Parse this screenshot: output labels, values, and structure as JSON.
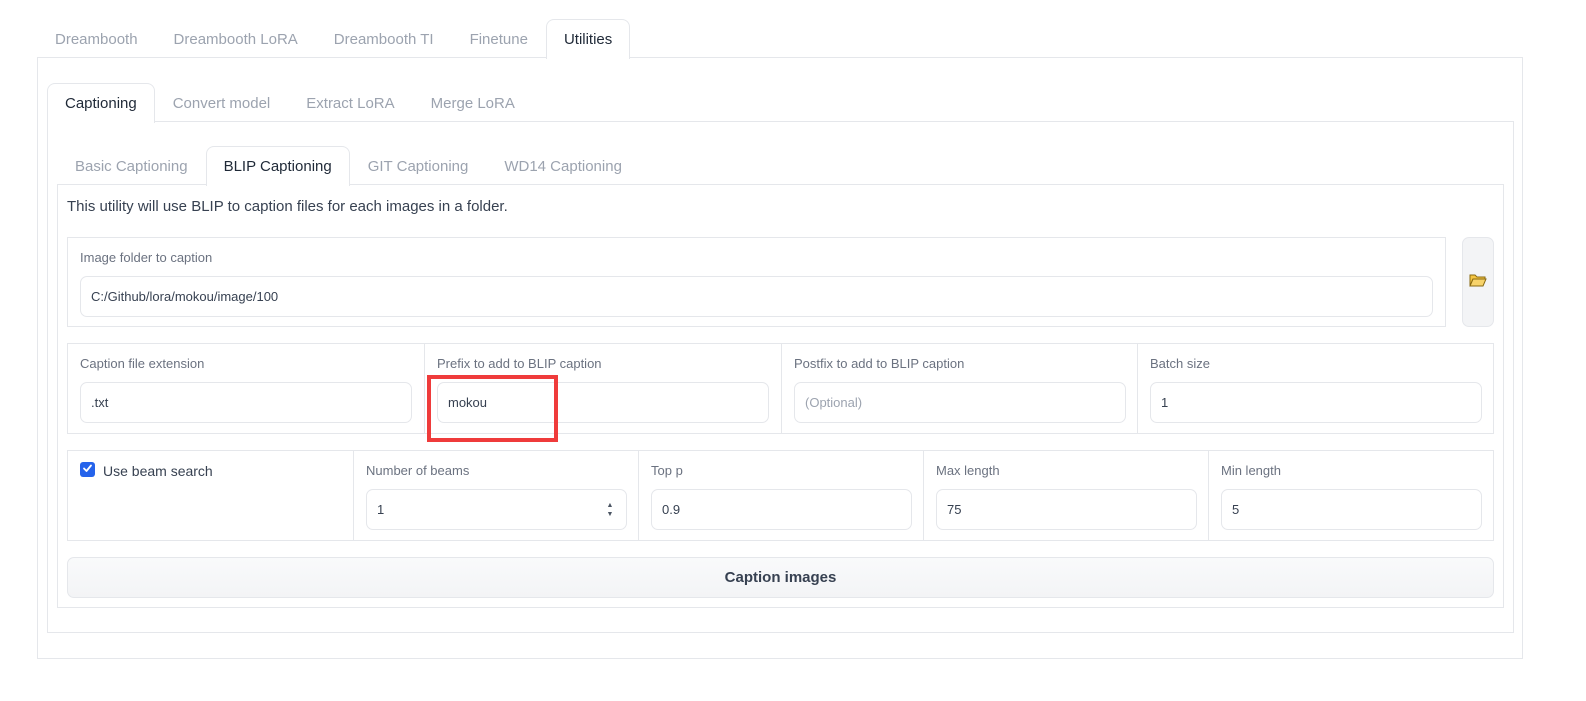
{
  "main_tabs": [
    "Dreambooth",
    "Dreambooth LoRA",
    "Dreambooth TI",
    "Finetune",
    "Utilities"
  ],
  "main_tab_active": "Utilities",
  "utility_tabs": [
    "Captioning",
    "Convert model",
    "Extract LoRA",
    "Merge LoRA"
  ],
  "utility_tab_active": "Captioning",
  "caption_tabs": [
    "Basic Captioning",
    "BLIP Captioning",
    "GIT Captioning",
    "WD14 Captioning"
  ],
  "caption_tab_active": "BLIP Captioning",
  "description": "This utility will use BLIP to caption files for each images in a folder.",
  "image_folder": {
    "label": "Image folder to caption",
    "value": "C:/Github/lora/mokou/image/100",
    "button_icon": "folder-open-icon"
  },
  "caption_ext": {
    "label": "Caption file extension",
    "value": ".txt"
  },
  "prefix": {
    "label": "Prefix to add to BLIP caption",
    "value": "mokou"
  },
  "postfix": {
    "label": "Postfix to add to BLIP caption",
    "value": "",
    "placeholder": "(Optional)"
  },
  "batch_size": {
    "label": "Batch size",
    "value": "1"
  },
  "beam_search": {
    "label": "Use beam search",
    "checked": true
  },
  "num_beams": {
    "label": "Number of beams",
    "value": "1"
  },
  "top_p": {
    "label": "Top p",
    "value": "0.9"
  },
  "max_length": {
    "label": "Max length",
    "value": "75"
  },
  "min_length": {
    "label": "Min length",
    "value": "5"
  },
  "submit_button": "Caption images",
  "colors": {
    "accent": "#2563eb",
    "highlight": "#ef3b3b",
    "border": "#e5e7eb"
  }
}
